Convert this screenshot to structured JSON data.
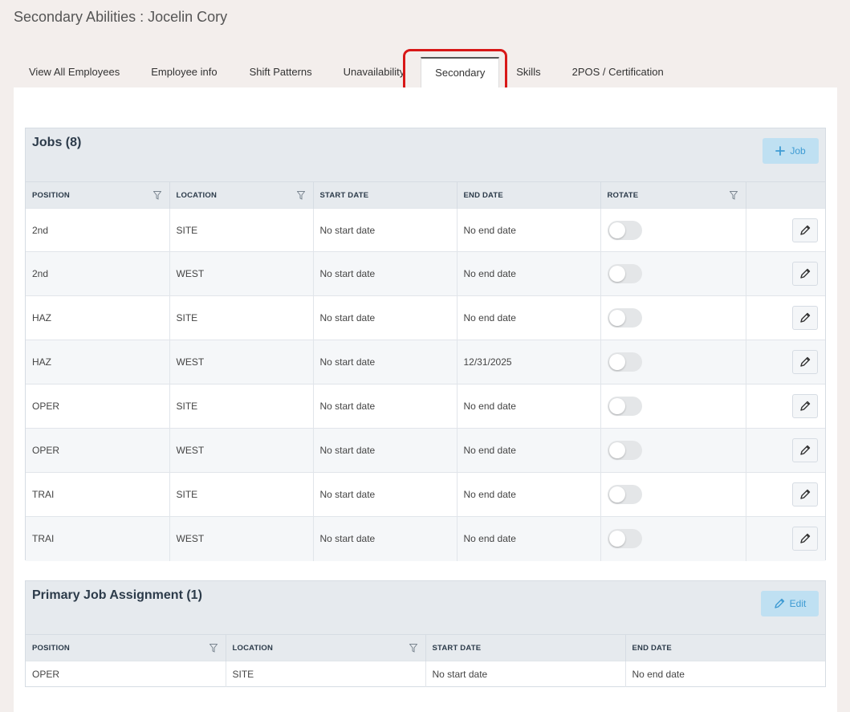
{
  "page_title": "Secondary Abilities : Jocelin Cory",
  "tabs": [
    {
      "label": "View All Employees"
    },
    {
      "label": "Employee info"
    },
    {
      "label": "Shift Patterns"
    },
    {
      "label": "Unavailability"
    },
    {
      "label": "Secondary",
      "active": true
    },
    {
      "label": "Skills"
    },
    {
      "label": "2POS / Certification"
    }
  ],
  "jobs": {
    "title": "Jobs (8)",
    "add_label": "Job",
    "columns": [
      "POSITION",
      "LOCATION",
      "START DATE",
      "END DATE",
      "ROTATE",
      ""
    ],
    "rows": [
      {
        "position": "2nd",
        "location": "SITE",
        "start": "No start date",
        "end": "No end date",
        "rotate": false
      },
      {
        "position": "2nd",
        "location": "WEST",
        "start": "No start date",
        "end": "No end date",
        "rotate": false
      },
      {
        "position": "HAZ",
        "location": "SITE",
        "start": "No start date",
        "end": "No end date",
        "rotate": false
      },
      {
        "position": "HAZ",
        "location": "WEST",
        "start": "No start date",
        "end": "12/31/2025",
        "rotate": false
      },
      {
        "position": "OPER",
        "location": "SITE",
        "start": "No start date",
        "end": "No end date",
        "rotate": false
      },
      {
        "position": "OPER",
        "location": "WEST",
        "start": "No start date",
        "end": "No end date",
        "rotate": false
      },
      {
        "position": "TRAI",
        "location": "SITE",
        "start": "No start date",
        "end": "No end date",
        "rotate": false
      },
      {
        "position": "TRAI",
        "location": "WEST",
        "start": "No start date",
        "end": "No end date",
        "rotate": false
      }
    ]
  },
  "primary": {
    "title": "Primary Job Assignment (1)",
    "edit_label": "Edit",
    "columns": [
      "POSITION",
      "LOCATION",
      "START DATE",
      "END DATE"
    ],
    "rows": [
      {
        "position": "OPER",
        "location": "SITE",
        "start": "No start date",
        "end": "No end date"
      }
    ]
  },
  "colors": {
    "background": "#f3eeec",
    "panel_header": "#e6eaee",
    "accent_button_bg": "#bfe0f2",
    "accent_button_text": "#3e9bd3",
    "highlight": "#d81818"
  },
  "icons": [
    "plus-icon",
    "filter-icon",
    "pencil-icon"
  ]
}
